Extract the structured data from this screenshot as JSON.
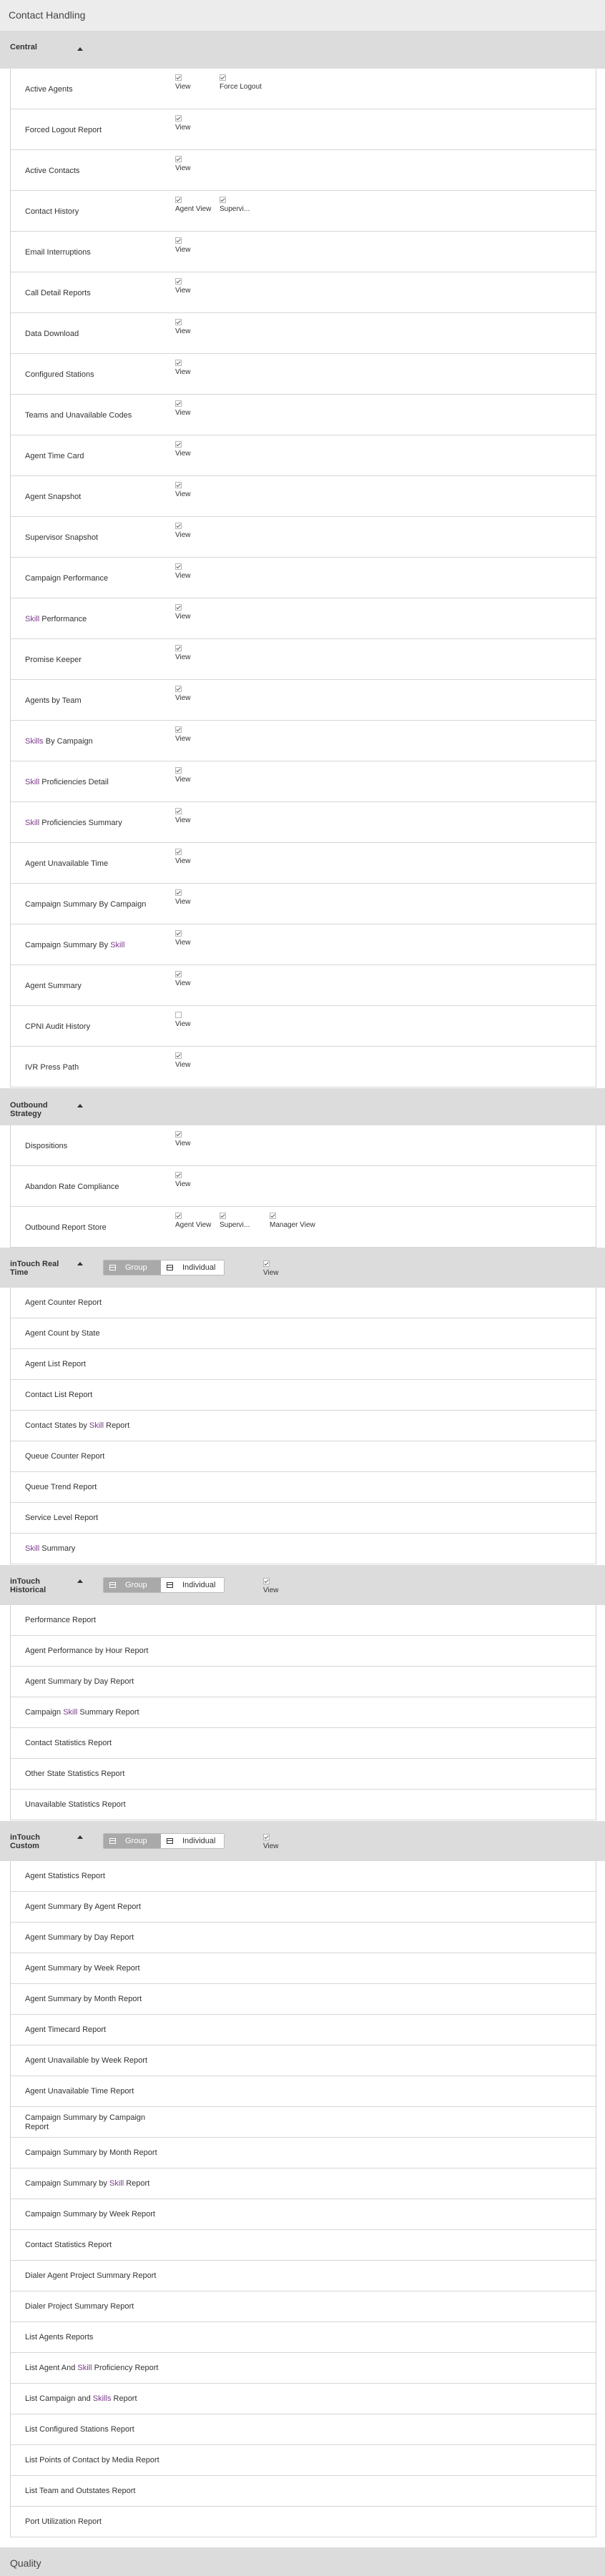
{
  "page": {
    "title": "Contact Handling"
  },
  "segment_labels": {
    "group": "Group",
    "individual": "Individual"
  },
  "sections": [
    {
      "id": "central",
      "title": "Central",
      "rows": [
        {
          "label": "Active Agents",
          "perms": [
            {
              "label": "View",
              "checked": true
            },
            {
              "label": "Force Logout",
              "checked": true
            }
          ]
        },
        {
          "label": "Forced Logout Report",
          "perms": [
            {
              "label": "View",
              "checked": true
            }
          ]
        },
        {
          "label": "Active Contacts",
          "perms": [
            {
              "label": "View",
              "checked": true
            }
          ]
        },
        {
          "label": "Contact History",
          "perms": [
            {
              "label": "Agent View",
              "checked": true
            },
            {
              "label": "Supervi...",
              "checked": true
            }
          ]
        },
        {
          "label": "Email Interruptions",
          "perms": [
            {
              "label": "View",
              "checked": true
            }
          ]
        },
        {
          "label": "Call Detail Reports",
          "perms": [
            {
              "label": "View",
              "checked": true
            }
          ]
        },
        {
          "label": "Data Download",
          "perms": [
            {
              "label": "View",
              "checked": true
            }
          ]
        },
        {
          "label": "Configured Stations",
          "perms": [
            {
              "label": "View",
              "checked": true
            }
          ]
        },
        {
          "label": "Teams and Unavailable Codes",
          "perms": [
            {
              "label": "View",
              "checked": true
            }
          ]
        },
        {
          "label": "Agent Time Card",
          "perms": [
            {
              "label": "View",
              "checked": true
            }
          ]
        },
        {
          "label": "Agent Snapshot",
          "perms": [
            {
              "label": "View",
              "checked": true
            }
          ]
        },
        {
          "label": "Supervisor Snapshot",
          "perms": [
            {
              "label": "View",
              "checked": true
            }
          ]
        },
        {
          "label": "Campaign Performance",
          "perms": [
            {
              "label": "View",
              "checked": true
            }
          ]
        },
        {
          "label": "Skill Performance",
          "perms": [
            {
              "label": "View",
              "checked": true
            }
          ]
        },
        {
          "label": "Promise Keeper",
          "perms": [
            {
              "label": "View",
              "checked": true
            }
          ]
        },
        {
          "label": "Agents by Team",
          "perms": [
            {
              "label": "View",
              "checked": true
            }
          ]
        },
        {
          "label": "Skills By Campaign",
          "perms": [
            {
              "label": "View",
              "checked": true
            }
          ]
        },
        {
          "label": "Skill Proficiencies Detail",
          "perms": [
            {
              "label": "View",
              "checked": true
            }
          ]
        },
        {
          "label": "Skill Proficiencies Summary",
          "perms": [
            {
              "label": "View",
              "checked": true
            }
          ]
        },
        {
          "label": "Agent Unavailable Time",
          "perms": [
            {
              "label": "View",
              "checked": true
            }
          ]
        },
        {
          "label": "Campaign Summary By Campaign",
          "perms": [
            {
              "label": "View",
              "checked": true
            }
          ]
        },
        {
          "label": "Campaign Summary By Skill",
          "perms": [
            {
              "label": "View",
              "checked": true
            }
          ]
        },
        {
          "label": "Agent Summary",
          "perms": [
            {
              "label": "View",
              "checked": true
            }
          ]
        },
        {
          "label": "CPNI Audit History",
          "perms": [
            {
              "label": "View",
              "checked": false
            }
          ]
        },
        {
          "label": "IVR Press Path",
          "perms": [
            {
              "label": "View",
              "checked": true
            }
          ]
        }
      ]
    },
    {
      "id": "outbound",
      "title": "Outbound Strategy",
      "rows": [
        {
          "label": "Dispositions",
          "perms": [
            {
              "label": "View",
              "checked": true
            }
          ]
        },
        {
          "label": "Abandon Rate Compliance",
          "perms": [
            {
              "label": "View",
              "checked": true
            }
          ]
        },
        {
          "label": "Outbound Report Store",
          "perms": [
            {
              "label": "Agent View",
              "checked": true
            },
            {
              "label": "Supervi...",
              "checked": true
            },
            {
              "label": "Manager View",
              "checked": true
            }
          ]
        }
      ]
    },
    {
      "id": "intouch-realtime",
      "title": "inTouch Real Time",
      "header_view": {
        "label": "View",
        "checked": true
      },
      "rows": [
        {
          "label": "Agent Counter Report"
        },
        {
          "label": "Agent Count by State"
        },
        {
          "label": "Agent List Report"
        },
        {
          "label": "Contact List Report"
        },
        {
          "label": "Contact States by Skill Report"
        },
        {
          "label": "Queue Counter Report"
        },
        {
          "label": "Queue Trend Report"
        },
        {
          "label": "Service Level Report"
        },
        {
          "label": "Skill Summary"
        }
      ]
    },
    {
      "id": "intouch-historical",
      "title": "inTouch Historical",
      "header_view": {
        "label": "View",
        "checked": true
      },
      "rows": [
        {
          "label": "Performance Report"
        },
        {
          "label": "Agent Performance by Hour Report"
        },
        {
          "label": "Agent Summary by Day Report"
        },
        {
          "label": "Campaign Skill Summary Report"
        },
        {
          "label": "Contact Statistics Report"
        },
        {
          "label": "Other State Statistics Report"
        },
        {
          "label": "Unavailable Statistics Report"
        }
      ]
    },
    {
      "id": "intouch-custom",
      "title": "inTouch Custom",
      "header_view": {
        "label": "View",
        "checked": true
      },
      "rows": [
        {
          "label": "Agent Statistics Report"
        },
        {
          "label": "Agent Summary By Agent Report"
        },
        {
          "label": "Agent Summary by Day Report"
        },
        {
          "label": "Agent Summary by Week Report"
        },
        {
          "label": "Agent Summary by Month Report"
        },
        {
          "label": "Agent Timecard Report"
        },
        {
          "label": "Agent Unavailable by Week Report"
        },
        {
          "label": "Agent Unavailable Time Report"
        },
        {
          "label": "Campaign Summary by Campaign Report"
        },
        {
          "label": "Campaign Summary by Month Report"
        },
        {
          "label": "Campaign Summary by Skill Report"
        },
        {
          "label": "Campaign Summary by Week Report"
        },
        {
          "label": "Contact Statistics Report"
        },
        {
          "label": "Dialer Agent Project Summary Report"
        },
        {
          "label": "Dialer Project Summary Report"
        },
        {
          "label": "List Agents Reports"
        },
        {
          "label": "List Agent And Skill Proficiency Report"
        },
        {
          "label": "List Campaign and Skills Report"
        },
        {
          "label": "List Configured Stations Report"
        },
        {
          "label": "List Points of Contact by Media Report"
        },
        {
          "label": "List Team and Outstates Report"
        },
        {
          "label": "Port Utilization Report"
        }
      ]
    }
  ],
  "footer": {
    "title": "Quality"
  },
  "colors": {
    "section_bg": "#dcdcdc",
    "skill_text": "#7b3a8a",
    "segment_active": "#a9a9a9"
  }
}
